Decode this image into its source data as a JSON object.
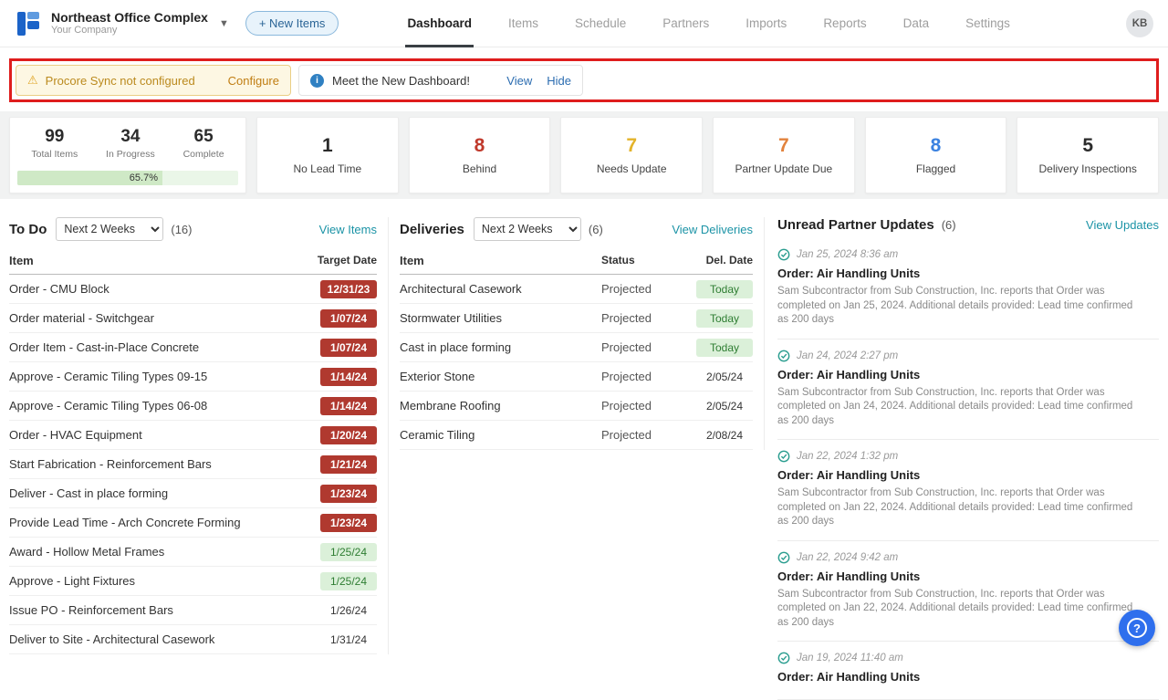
{
  "header": {
    "project_name": "Northeast Office Complex",
    "company_name": "Your Company",
    "new_items_label": "+ New Items",
    "nav": {
      "dashboard": "Dashboard",
      "items": "Items",
      "schedule": "Schedule",
      "partners": "Partners",
      "imports": "Imports",
      "reports": "Reports",
      "data": "Data",
      "settings": "Settings"
    },
    "active_tab": "Dashboard",
    "avatar_initials": "KB"
  },
  "banners": {
    "procore": {
      "text": "Procore Sync not configured",
      "action": "Configure"
    },
    "dashboard": {
      "text": "Meet the New Dashboard!",
      "view": "View",
      "hide": "Hide"
    }
  },
  "stats": {
    "summary": {
      "total_value": "99",
      "total_label": "Total Items",
      "in_progress_value": "34",
      "in_progress_label": "In Progress",
      "complete_value": "65",
      "complete_label": "Complete",
      "progress_pct": "65.7%"
    },
    "cards": [
      {
        "value": "1",
        "label": "No Lead Time",
        "color": "#2b2b2b"
      },
      {
        "value": "8",
        "label": "Behind",
        "color": "#c0392b"
      },
      {
        "value": "7",
        "label": "Needs Update",
        "color": "#e3b32a"
      },
      {
        "value": "7",
        "label": "Partner Update Due",
        "color": "#e2823c"
      },
      {
        "value": "8",
        "label": "Flagged",
        "color": "#3b82e0"
      },
      {
        "value": "5",
        "label": "Delivery Inspections",
        "color": "#2b2b2b"
      }
    ]
  },
  "todo": {
    "title": "To Do",
    "filter_value": "Next 2 Weeks",
    "count": "(16)",
    "view_link": "View Items",
    "col_item": "Item",
    "col_date": "Target Date",
    "rows": [
      {
        "item": "Order - CMU Block",
        "date": "12/31/23",
        "badge": "red"
      },
      {
        "item": "Order material - Switchgear",
        "date": "1/07/24",
        "badge": "red"
      },
      {
        "item": "Order Item - Cast-in-Place Concrete",
        "date": "1/07/24",
        "badge": "red"
      },
      {
        "item": "Approve - Ceramic Tiling Types 09-15",
        "date": "1/14/24",
        "badge": "red"
      },
      {
        "item": "Approve - Ceramic Tiling Types 06-08",
        "date": "1/14/24",
        "badge": "red"
      },
      {
        "item": "Order - HVAC Equipment",
        "date": "1/20/24",
        "badge": "red"
      },
      {
        "item": "Start Fabrication - Reinforcement Bars",
        "date": "1/21/24",
        "badge": "red"
      },
      {
        "item": "Deliver - Cast in place forming",
        "date": "1/23/24",
        "badge": "red"
      },
      {
        "item": "Provide Lead Time - Arch Concrete Forming",
        "date": "1/23/24",
        "badge": "red"
      },
      {
        "item": "Award - Hollow Metal Frames",
        "date": "1/25/24",
        "badge": "green"
      },
      {
        "item": "Approve - Light Fixtures",
        "date": "1/25/24",
        "badge": "green"
      },
      {
        "item": "Issue PO - Reinforcement Bars",
        "date": "1/26/24",
        "badge": "none"
      },
      {
        "item": "Deliver to Site - Architectural Casework",
        "date": "1/31/24",
        "badge": "none"
      }
    ]
  },
  "deliveries": {
    "title": "Deliveries",
    "filter_value": "Next 2 Weeks",
    "count": "(6)",
    "view_link": "View Deliveries",
    "col_item": "Item",
    "col_status": "Status",
    "col_date": "Del. Date",
    "rows": [
      {
        "item": "Architectural Casework",
        "status": "Projected",
        "date": "Today",
        "badge": "green"
      },
      {
        "item": "Stormwater Utilities",
        "status": "Projected",
        "date": "Today",
        "badge": "green"
      },
      {
        "item": "Cast in place forming",
        "status": "Projected",
        "date": "Today",
        "badge": "green"
      },
      {
        "item": "Exterior Stone",
        "status": "Projected",
        "date": "2/05/24",
        "badge": "none"
      },
      {
        "item": "Membrane Roofing",
        "status": "Projected",
        "date": "2/05/24",
        "badge": "none"
      },
      {
        "item": "Ceramic Tiling",
        "status": "Projected",
        "date": "2/08/24",
        "badge": "none"
      }
    ]
  },
  "updates": {
    "title": "Unread Partner Updates",
    "count": "(6)",
    "view_link": "View Updates",
    "items": [
      {
        "time": "Jan 25, 2024 8:36 am",
        "title": "Order: Air Handling Units",
        "body": "Sam Subcontractor from Sub Construction, Inc. reports that Order was completed on Jan 25, 2024.   Additional details provided: Lead time confirmed as 200 days"
      },
      {
        "time": "Jan 24, 2024 2:27 pm",
        "title": "Order: Air Handling Units",
        "body": "Sam Subcontractor from Sub Construction, Inc. reports that Order was completed on Jan 24, 2024.   Additional details provided: Lead time confirmed as 200 days"
      },
      {
        "time": "Jan 22, 2024 1:32 pm",
        "title": "Order: Air Handling Units",
        "body": "Sam Subcontractor from Sub Construction, Inc. reports that Order was completed on Jan 22, 2024.   Additional details provided: Lead time confirmed as 200 days"
      },
      {
        "time": "Jan 22, 2024 9:42 am",
        "title": "Order: Air Handling Units",
        "body": "Sam Subcontractor from Sub Construction, Inc. reports that Order was completed on Jan 22, 2024.   Additional details provided: Lead time confirmed as 200 days"
      },
      {
        "time": "Jan 19, 2024 11:40 am",
        "title": "Order: Air Handling Units",
        "body": ""
      }
    ]
  },
  "help": {
    "label": "?"
  },
  "colors": {
    "accent_link_teal": "#1b93a6",
    "badge_red": "#b0392f",
    "badge_green_bg": "#dbf0d9",
    "annotation_red": "#df1d1d",
    "help_button_blue": "#2f6fed"
  }
}
